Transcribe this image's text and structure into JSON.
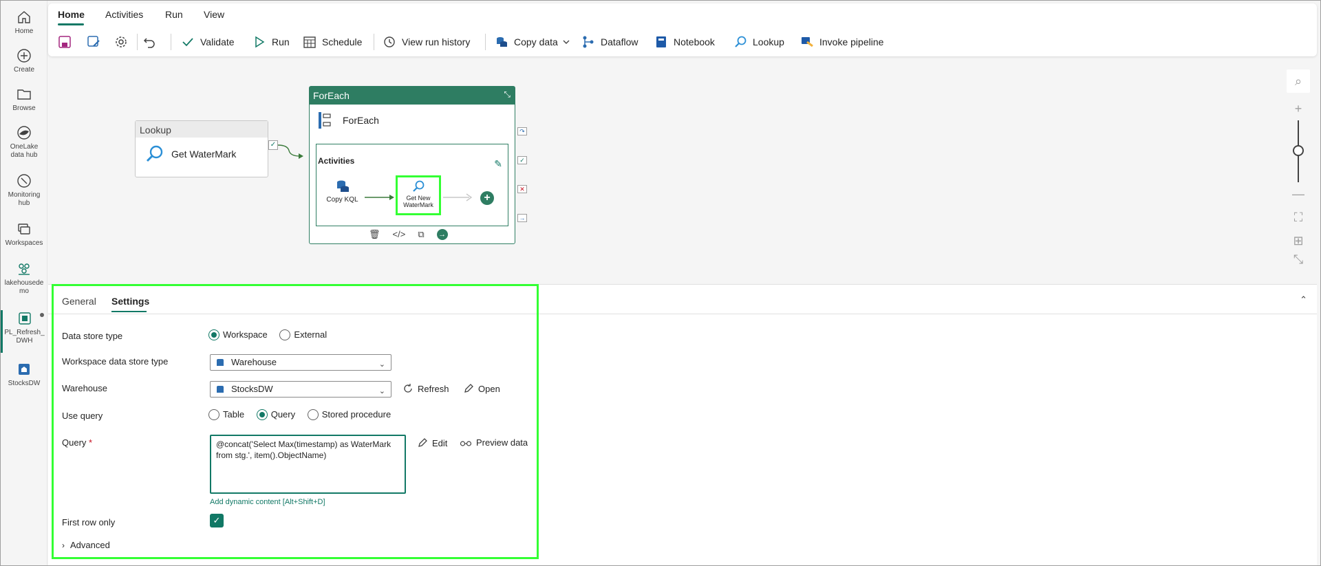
{
  "rail": {
    "items": [
      {
        "label": "Home"
      },
      {
        "label": "Create"
      },
      {
        "label": "Browse"
      },
      {
        "label": "OneLake data hub"
      },
      {
        "label": "Monitoring hub"
      },
      {
        "label": "Workspaces"
      },
      {
        "label": "lakehousedemo"
      },
      {
        "label": "PL_Refresh_DWH"
      },
      {
        "label": "StocksDW"
      }
    ]
  },
  "ribbon": {
    "tabs": [
      "Home",
      "Activities",
      "Run",
      "View"
    ],
    "active_tab": "Home",
    "buttons": {
      "validate": "Validate",
      "run": "Run",
      "schedule": "Schedule",
      "view_run_history": "View run history",
      "copy_data": "Copy data",
      "dataflow": "Dataflow",
      "notebook": "Notebook",
      "lookup": "Lookup",
      "invoke_pipeline": "Invoke pipeline"
    }
  },
  "canvas": {
    "lookup_node": {
      "header": "Lookup",
      "name": "Get WaterMark"
    },
    "foreach_node": {
      "header": "ForEach",
      "name": "ForEach",
      "activities_label": "Activities",
      "inner": [
        {
          "name": "Copy KQL"
        },
        {
          "name": "Get New WaterMark"
        }
      ]
    }
  },
  "panel": {
    "tabs": [
      "General",
      "Settings"
    ],
    "active_tab": "Settings",
    "data_store_type": {
      "label": "Data store type",
      "options": [
        "Workspace",
        "External"
      ],
      "selected": "Workspace"
    },
    "workspace_data_store_type": {
      "label": "Workspace data store type",
      "value": "Warehouse"
    },
    "warehouse": {
      "label": "Warehouse",
      "value": "StocksDW",
      "refresh": "Refresh",
      "open": "Open"
    },
    "use_query": {
      "label": "Use query",
      "options": [
        "Table",
        "Query",
        "Stored procedure"
      ],
      "selected": "Query"
    },
    "query": {
      "label": "Query",
      "required_mark": "*",
      "value": "@concat('Select Max(timestamp) as WaterMark from stg.', item().ObjectName)",
      "edit": "Edit",
      "preview": "Preview data",
      "dynamic_link": "Add dynamic content [Alt+Shift+D]"
    },
    "first_row_only": {
      "label": "First row only",
      "checked": true
    },
    "advanced": {
      "label": "Advanced"
    }
  },
  "colors": {
    "accent": "#117865",
    "highlight": "#33ff33",
    "node_header": "#2e7d62"
  }
}
